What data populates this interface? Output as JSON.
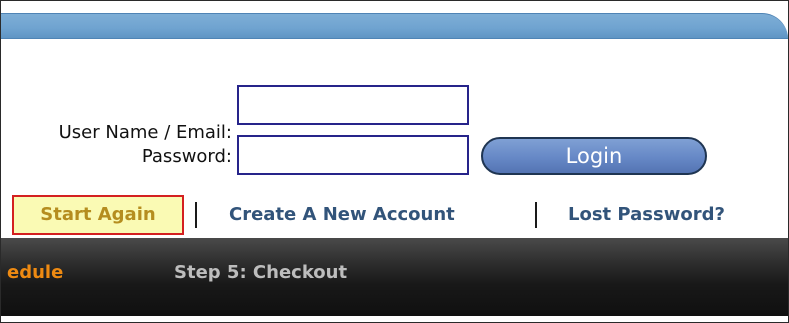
{
  "login_form": {
    "username_label": "User Name / Email:",
    "password_label": "Password:",
    "username_value": "",
    "password_value": "",
    "login_button": "Login"
  },
  "links": {
    "start_again": "Start Again",
    "create_account": "Create A New Account",
    "lost_password": "Lost Password?"
  },
  "steps": {
    "current_partial": "edule",
    "next": "Step 5: Checkout"
  },
  "colors": {
    "header_bar": "#6fa3d0",
    "field_border": "#26248a",
    "login_button": "#6688c6",
    "start_again_highlight": "#fafab4",
    "start_again_border": "#d42020",
    "link": "#32547a",
    "step_active": "#ee8a12",
    "step_inactive": "#bdbdbd",
    "steps_bar": "#181818"
  }
}
